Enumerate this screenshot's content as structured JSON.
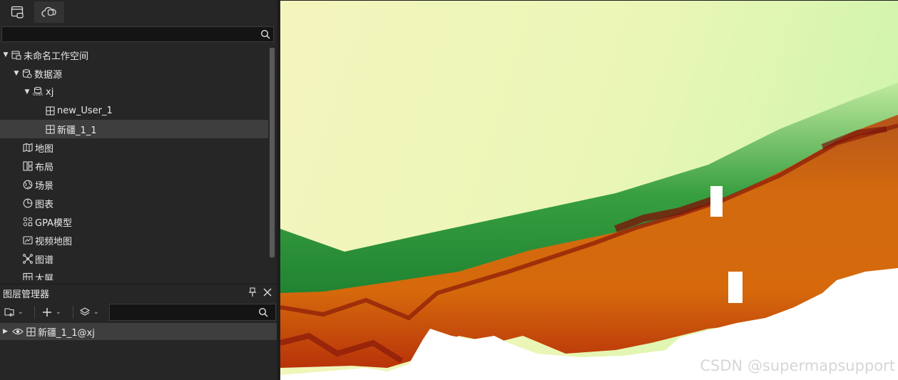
{
  "workspace_tree": {
    "search_value": "",
    "items": [
      {
        "label": "未命名工作空间",
        "icon": "workspace-icon"
      },
      {
        "label": "数据源",
        "icon": "datasources-icon"
      },
      {
        "label": "xj",
        "icon": "udbx-datasource-icon",
        "icon_text": "UDBX"
      },
      {
        "label": "new_User_1",
        "icon": "grid-dataset-icon"
      },
      {
        "label": "新疆_1_1",
        "icon": "grid-dataset-icon",
        "selected": true
      },
      {
        "label": "地图",
        "icon": "map-icon"
      },
      {
        "label": "布局",
        "icon": "layout-icon"
      },
      {
        "label": "场景",
        "icon": "scene-icon"
      },
      {
        "label": "图表",
        "icon": "chart-icon"
      },
      {
        "label": "GPA模型",
        "icon": "gpa-model-icon"
      },
      {
        "label": "视频地图",
        "icon": "video-map-icon"
      },
      {
        "label": "图谱",
        "icon": "graph-icon"
      },
      {
        "label": "大屏",
        "icon": "dashboard-icon"
      }
    ]
  },
  "layer_manager": {
    "title": "图层管理器",
    "search_value": "",
    "layers": [
      {
        "label": "新疆_1_1@xj",
        "visible": true
      }
    ]
  },
  "map": {
    "watermark": "CSDN @supermapsupport"
  },
  "colors": {
    "panel_bg": "#262626",
    "selected_row": "#3e3e3e",
    "input_bg": "#141414",
    "dem_low": "#f0f6c0",
    "dem_mid": "#1f8f2c",
    "dem_high": "#c43a08"
  }
}
